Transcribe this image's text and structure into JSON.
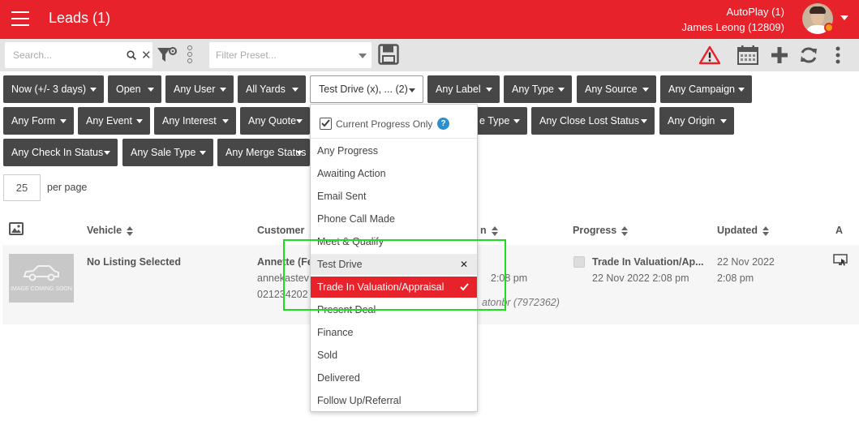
{
  "header": {
    "title": "Leads (1)",
    "account": "AutoPlay (1)",
    "user": "James Leong (12809)",
    "accent_color": "#e8222a",
    "status_color": "#f39c12"
  },
  "toolbar": {
    "search_placeholder": "Search...",
    "preset_placeholder": "Filter Preset...",
    "icons": [
      "search-icon",
      "clear-icon",
      "filter-settings-icon",
      "more-vertical-icon",
      "save-icon",
      "warning-icon",
      "calendar-icon",
      "add-icon",
      "refresh-icon",
      "more-vertical-icon"
    ]
  },
  "filters": {
    "row1": [
      "Now (+/- 3 days)",
      "Open",
      "Any User",
      "All Yards",
      "Test Drive (x), ... (2)",
      "Any Label",
      "Any Type",
      "Any Source",
      "Any Campaign"
    ],
    "row2": [
      "Any Form",
      "Any Event",
      "Any Interest",
      "Any Quote",
      "e Type",
      "Any Close Lost Status",
      "Any Origin"
    ],
    "row3": [
      "Any Check In Status",
      "Any Sale Type",
      "Any Merge Status"
    ]
  },
  "pagination": {
    "per_page_value": "25",
    "per_page_label": "per page"
  },
  "table": {
    "columns": {
      "vehicle": "Vehicle",
      "customer": "Customer",
      "col4_fragment": "n",
      "progress": "Progress",
      "updated": "Updated",
      "trailing": "A"
    },
    "row": {
      "thumb_text": "IMAGE COMING SOON",
      "vehicle": "No Listing Selected",
      "customer_name": "Annette (Fe",
      "customer_email": "annekastev",
      "customer_phone": "021234202",
      "col4_time": "2:08 pm",
      "col4_note": "atonbr (7972362)",
      "progress_stage": "Trade In Valuation/Ap...",
      "progress_time": "22 Nov 2022 2:08 pm",
      "updated_date": "22 Nov 2022",
      "updated_time": "2:08 pm"
    }
  },
  "dropdown": {
    "current_only_label": "Current Progress Only",
    "current_only_checked": true,
    "items": [
      "Any Progress",
      "Awaiting Action",
      "Email Sent",
      "Phone Call Made",
      "Meet & Qualify",
      "Test Drive",
      "Trade In Valuation/Appraisal",
      "Present Deal",
      "Finance",
      "Sold",
      "Delivered",
      "Follow Up/Referral"
    ],
    "hovered": "Test Drive",
    "selected": "Trade In Valuation/Appraisal"
  }
}
